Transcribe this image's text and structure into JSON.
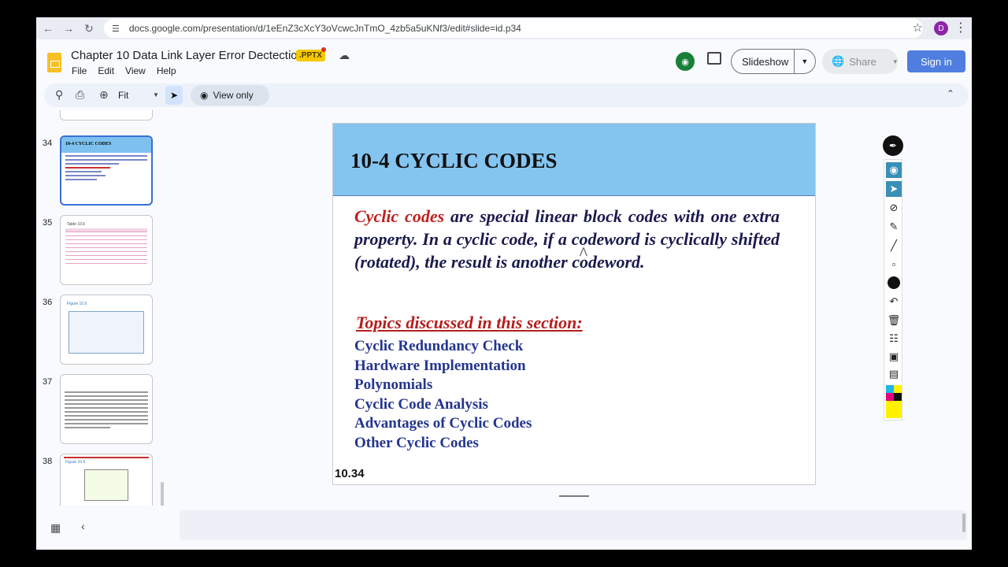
{
  "browser": {
    "url": "docs.google.com/presentation/d/1eEnZ3cXcY3oVcwcJnTmO_4zb5a5uKNf3/edit#slide=id.p34",
    "profile_initial": "D"
  },
  "app": {
    "title": "Chapter 10 Data Link Layer Error Dectection",
    "file_badge": ".PPTX",
    "menu": [
      "File",
      "Edit",
      "View",
      "Help"
    ],
    "slideshow_label": "Slideshow",
    "share_label": "Share",
    "signin_label": "Sign in"
  },
  "toolbar": {
    "zoom_label": "Fit",
    "view_only_label": "View only"
  },
  "filmstrip": {
    "thumbnails": [
      {
        "number": "34",
        "header": "10-4 CYCLIC CODES",
        "active": true
      },
      {
        "number": "35",
        "header": "Table 10.6",
        "active": false
      },
      {
        "number": "36",
        "header": "Figure 10.5",
        "active": false
      },
      {
        "number": "37",
        "header": "",
        "active": false
      },
      {
        "number": "38",
        "header": "Figure 10.6",
        "active": false
      }
    ]
  },
  "slide": {
    "title": "10-4   CYCLIC CODES",
    "highlight": "Cyclic codes",
    "paragraph_rest": " are special linear block codes with one extra property. In a cyclic code, if a codeword is cyclically shifted (rotated), the result is another codeword.",
    "topics_heading": "Topics discussed in this section:",
    "topics": [
      "Cyclic Redundancy Check",
      "Hardware Implementation",
      "Polynomials",
      "Cyclic Code Analysis",
      "Advantages of Cyclic Codes",
      "Other Cyclic Codes"
    ],
    "slide_number": "10.34"
  },
  "colors": {
    "header_blue": "#84c5f0",
    "highlight_red": "#c01f1f",
    "topic_blue": "#24358f",
    "signin_blue": "#4f7ee0"
  }
}
